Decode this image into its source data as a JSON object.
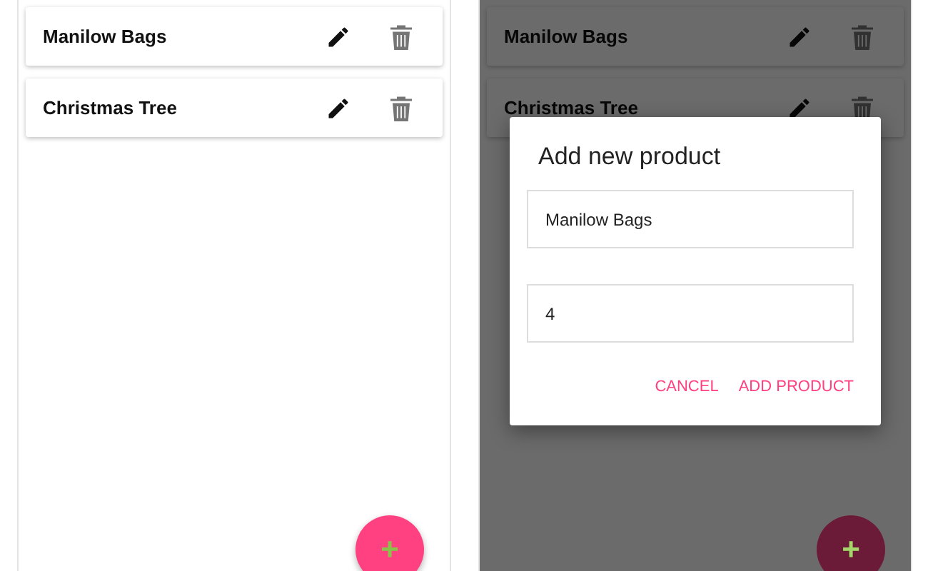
{
  "screens": [
    {
      "products": [
        {
          "name": "Manilow Bags"
        },
        {
          "name": "Christmas Tree"
        }
      ],
      "fab": "+"
    },
    {
      "products": [
        {
          "name": "Manilow Bags"
        },
        {
          "name": "Christmas Tree"
        }
      ],
      "fab": "+",
      "dialog": {
        "title": "Add new product",
        "fields": [
          {
            "value": "Manilow Bags"
          },
          {
            "value": "4"
          }
        ],
        "actions": [
          "CANCEL",
          "ADD PRODUCT"
        ]
      }
    }
  ]
}
